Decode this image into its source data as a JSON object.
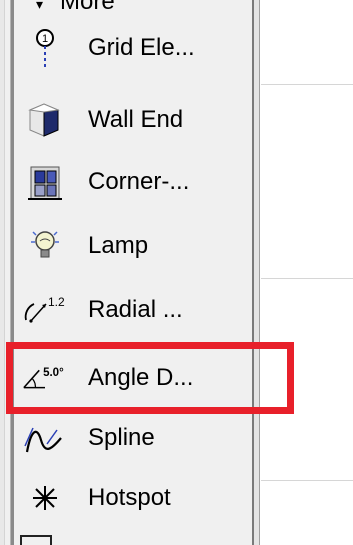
{
  "palette": {
    "top_partial_label": "More",
    "items": [
      {
        "icon": "grid-element-icon",
        "label": "Grid Ele..."
      },
      {
        "icon": "wall-end-icon",
        "label": "Wall End"
      },
      {
        "icon": "corner-window-icon",
        "label": "Corner-..."
      },
      {
        "icon": "lamp-icon",
        "label": "Lamp"
      },
      {
        "icon": "radial-dimension-icon",
        "label": "Radial ..."
      },
      {
        "icon": "angle-dimension-icon",
        "label": "Angle D..."
      },
      {
        "icon": "spline-icon",
        "label": "Spline"
      },
      {
        "icon": "hotspot-icon",
        "label": "Hotspot"
      }
    ],
    "radial_icon_text": "1.2",
    "angle_icon_text": "5.0°",
    "highlight_color": "#e8202a"
  }
}
